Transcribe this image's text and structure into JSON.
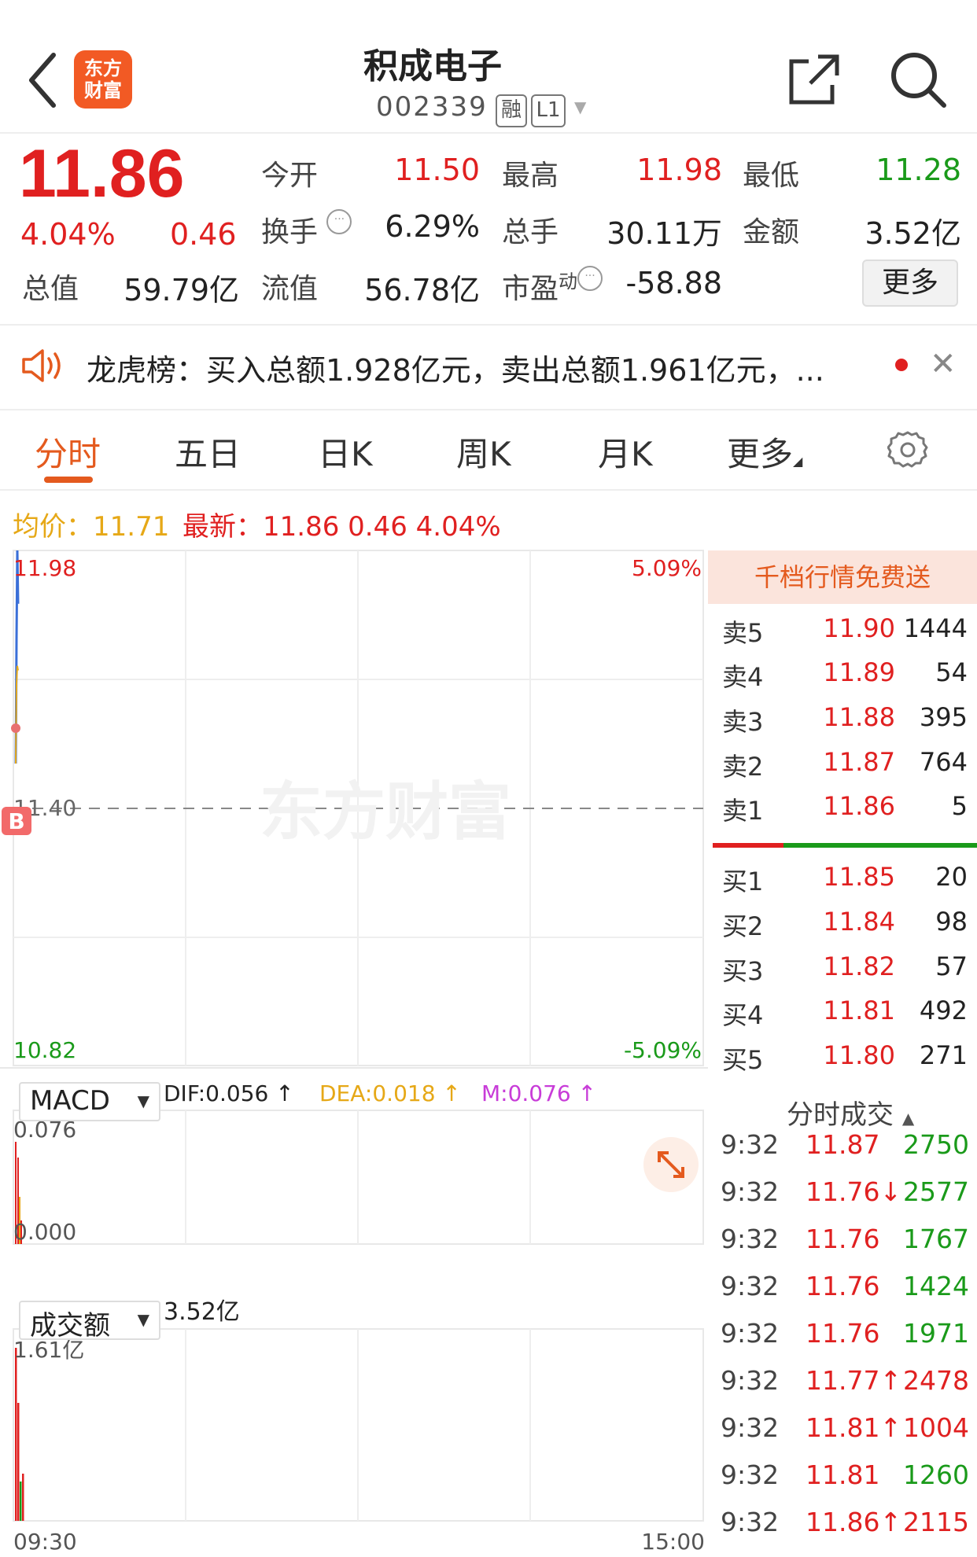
{
  "header": {
    "logo_line1": "东方",
    "logo_line2": "财富",
    "stock_name": "积成电子",
    "stock_code": "002339",
    "tag_margin": "融",
    "tag_level": "L1"
  },
  "quote": {
    "price": "11.86",
    "change_pct": "4.04%",
    "change_val": "0.46",
    "open_label": "今开",
    "open_val": "11.50",
    "high_label": "最高",
    "high_val": "11.98",
    "low_label": "最低",
    "low_val": "11.28",
    "turnover_label": "换手",
    "turnover_val": "6.29%",
    "volume_label": "总手",
    "volume_val": "30.11万",
    "amount_label": "金额",
    "amount_val": "3.52亿",
    "mktcap_label": "总值",
    "mktcap_val": "59.79亿",
    "float_label": "流值",
    "float_val": "56.78亿",
    "pe_label": "市盈",
    "pe_sup": "动",
    "pe_val": "-58.88",
    "more_label": "更多"
  },
  "notice": {
    "text": "龙虎榜：买入总额1.928亿元，卖出总额1.961亿元，..."
  },
  "tabs": [
    "分时",
    "五日",
    "日K",
    "周K",
    "月K",
    "更多"
  ],
  "chart_header": {
    "avg_label": "均价：11.71",
    "latest_label": "最新：11.86  0.46  4.04%"
  },
  "chart_data": {
    "type": "line",
    "y_top": "11.98",
    "y_mid": "11.40",
    "y_bottom": "10.82",
    "pct_top": "5.09%",
    "pct_bottom": "-5.09%",
    "x_start": "09:30",
    "x_end": "15:00",
    "ylim": [
      10.82,
      11.98
    ],
    "watermark": "东方财富",
    "marker": "B",
    "macd": {
      "indicator": "MACD",
      "dif": "DIF:0.056 ↑",
      "dea": "DEA:0.018 ↑",
      "m": "M:0.076 ↑",
      "y_top": "0.076",
      "y_bottom": "0.000"
    },
    "volume": {
      "indicator": "成交额",
      "total": "3.52亿",
      "y_top": "1.61亿"
    }
  },
  "order_book": {
    "banner": "千档行情免费送",
    "asks": [
      {
        "label": "卖5",
        "price": "11.90",
        "vol": "1444"
      },
      {
        "label": "卖4",
        "price": "11.89",
        "vol": "54"
      },
      {
        "label": "卖3",
        "price": "11.88",
        "vol": "395"
      },
      {
        "label": "卖2",
        "price": "11.87",
        "vol": "764"
      },
      {
        "label": "卖1",
        "price": "11.86",
        "vol": "5"
      }
    ],
    "bids": [
      {
        "label": "买1",
        "price": "11.85",
        "vol": "20"
      },
      {
        "label": "买2",
        "price": "11.84",
        "vol": "98"
      },
      {
        "label": "买3",
        "price": "11.82",
        "vol": "57"
      },
      {
        "label": "买4",
        "price": "11.81",
        "vol": "492"
      },
      {
        "label": "买5",
        "price": "11.80",
        "vol": "271"
      }
    ]
  },
  "trades": {
    "title": "分时成交",
    "rows": [
      {
        "time": "9:32",
        "price": "11.87",
        "vol": "2750",
        "price_color": "#e02020",
        "vol_color": "#1a9a1a"
      },
      {
        "time": "9:32",
        "price": "11.76↓",
        "vol": "2577",
        "price_color": "#e02020",
        "vol_color": "#1a9a1a"
      },
      {
        "time": "9:32",
        "price": "11.76",
        "vol": "1767",
        "price_color": "#e02020",
        "vol_color": "#1a9a1a"
      },
      {
        "time": "9:32",
        "price": "11.76",
        "vol": "1424",
        "price_color": "#e02020",
        "vol_color": "#1a9a1a"
      },
      {
        "time": "9:32",
        "price": "11.76",
        "vol": "1971",
        "price_color": "#e02020",
        "vol_color": "#1a9a1a"
      },
      {
        "time": "9:32",
        "price": "11.77↑",
        "vol": "2478",
        "price_color": "#e02020",
        "vol_color": "#e02020"
      },
      {
        "time": "9:32",
        "price": "11.81↑",
        "vol": "1004",
        "price_color": "#e02020",
        "vol_color": "#e02020"
      },
      {
        "time": "9:32",
        "price": "11.81",
        "vol": "1260",
        "price_color": "#e02020",
        "vol_color": "#1a9a1a"
      },
      {
        "time": "9:32",
        "price": "11.86↑",
        "vol": "2115",
        "price_color": "#e02020",
        "vol_color": "#e02020"
      }
    ]
  }
}
